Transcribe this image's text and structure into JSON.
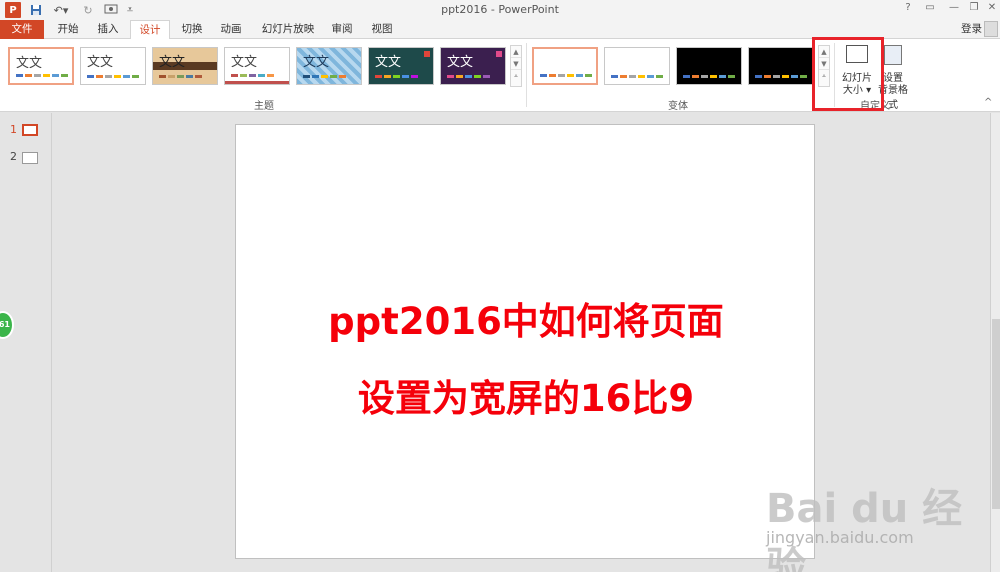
{
  "window": {
    "title": "ppt2016 - PowerPoint"
  },
  "tabs": [
    {
      "label": "文件"
    },
    {
      "label": "开始"
    },
    {
      "label": "插入"
    },
    {
      "label": "设计"
    },
    {
      "label": "切换"
    },
    {
      "label": "动画"
    },
    {
      "label": "幻灯片放映"
    },
    {
      "label": "审阅"
    },
    {
      "label": "视图"
    }
  ],
  "account": {
    "login_label": "登录"
  },
  "ribbon": {
    "themes_group_label": "主题",
    "variants_group_label": "变体",
    "customize_group_label": "自定义",
    "theme_sample_text": "文文",
    "slide_size_label_line1": "幻灯片",
    "slide_size_label_line2": "大小 ▾",
    "format_bg_label_line1": "设置",
    "format_bg_label_line2": "背景格式"
  },
  "slides_panel": {
    "numbers": [
      "1",
      "2"
    ],
    "badge": "61"
  },
  "slide": {
    "line1": "ppt2016中如何将页面",
    "line2": "设置为宽屏的16比9"
  },
  "watermark": {
    "brand": "Bai du 经验",
    "url": "jingyan.baidu.com"
  },
  "colors": {
    "accent": "#d24726",
    "slide_text": "#f5000a",
    "highlight": "#e8232a"
  }
}
